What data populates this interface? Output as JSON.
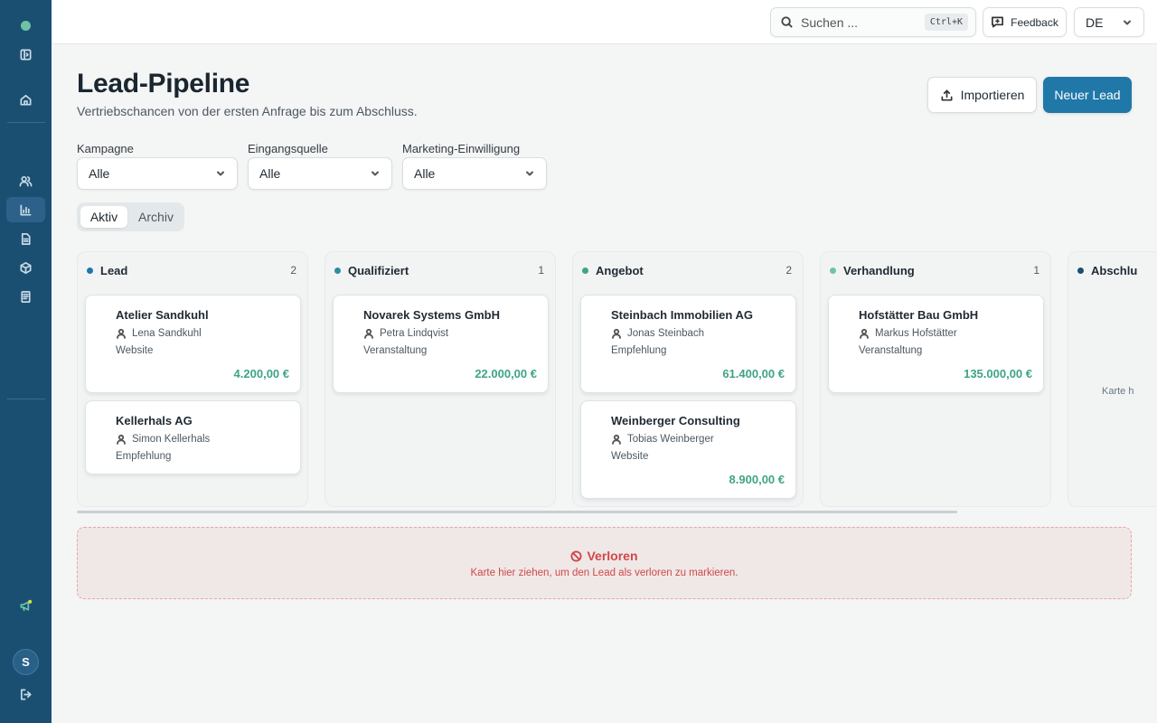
{
  "sidebar": {
    "icons": [
      "brand-dot",
      "panel-toggle-icon",
      "home-icon",
      "users-icon",
      "chart-icon",
      "document-icon",
      "box-icon",
      "receipt-icon",
      "megaphone-icon",
      "logout-icon"
    ],
    "active_item": "chart-icon",
    "avatar_initial": "S"
  },
  "topbar": {
    "search_placeholder": "Suchen ...",
    "search_shortcut": "Ctrl+K",
    "feedback_label": "Feedback",
    "language": "DE"
  },
  "header": {
    "title": "Lead-Pipeline",
    "subtitle": "Vertriebschancen von der ersten Anfrage bis zum Abschluss.",
    "import_label": "Importieren",
    "new_lead_label": "Neuer Lead"
  },
  "filters": [
    {
      "label": "Kampagne",
      "value": "Alle"
    },
    {
      "label": "Eingangsquelle",
      "value": "Alle"
    },
    {
      "label": "Marketing-Einwilligung",
      "value": "Alle"
    }
  ],
  "tabs": [
    {
      "label": "Aktiv",
      "active": true
    },
    {
      "label": "Archiv",
      "active": false
    }
  ],
  "columns": [
    {
      "title": "Lead",
      "count": "2",
      "dot_color": "#1f78a8",
      "cards": [
        {
          "name": "Atelier Sandkuhl",
          "person": "Lena Sandkuhl",
          "source": "Website",
          "amount": "4.200,00 €"
        },
        {
          "name": "Kellerhals AG",
          "person": "Simon Kellerhals",
          "source": "Empfehlung",
          "amount": ""
        }
      ]
    },
    {
      "title": "Qualifiziert",
      "count": "1",
      "dot_color": "#2a8fa0",
      "cards": [
        {
          "name": "Novarek Systems GmbH",
          "person": "Petra Lindqvist",
          "source": "Veranstaltung",
          "amount": "22.000,00 €"
        }
      ]
    },
    {
      "title": "Angebot",
      "count": "2",
      "dot_color": "#3ea487",
      "cards": [
        {
          "name": "Steinbach Immobilien AG",
          "person": "Jonas Steinbach",
          "source": "Empfehlung",
          "amount": "61.400,00 €"
        },
        {
          "name": "Weinberger Consulting",
          "person": "Tobias Weinberger",
          "source": "Website",
          "amount": "8.900,00 €"
        }
      ]
    },
    {
      "title": "Verhandlung",
      "count": "1",
      "dot_color": "#6fc3a5",
      "cards": [
        {
          "name": "Hofstätter Bau GmbH",
          "person": "Markus Hofstätter",
          "source": "Veranstaltung",
          "amount": "135.000,00 €"
        }
      ]
    },
    {
      "title": "Abschlu",
      "count": "",
      "dot_color": "#1b4f72",
      "placeholder": "Karte h",
      "cards": []
    }
  ],
  "lost_zone": {
    "title": "Verloren",
    "hint": "Karte hier ziehen, um den Lead als verloren zu markieren."
  }
}
